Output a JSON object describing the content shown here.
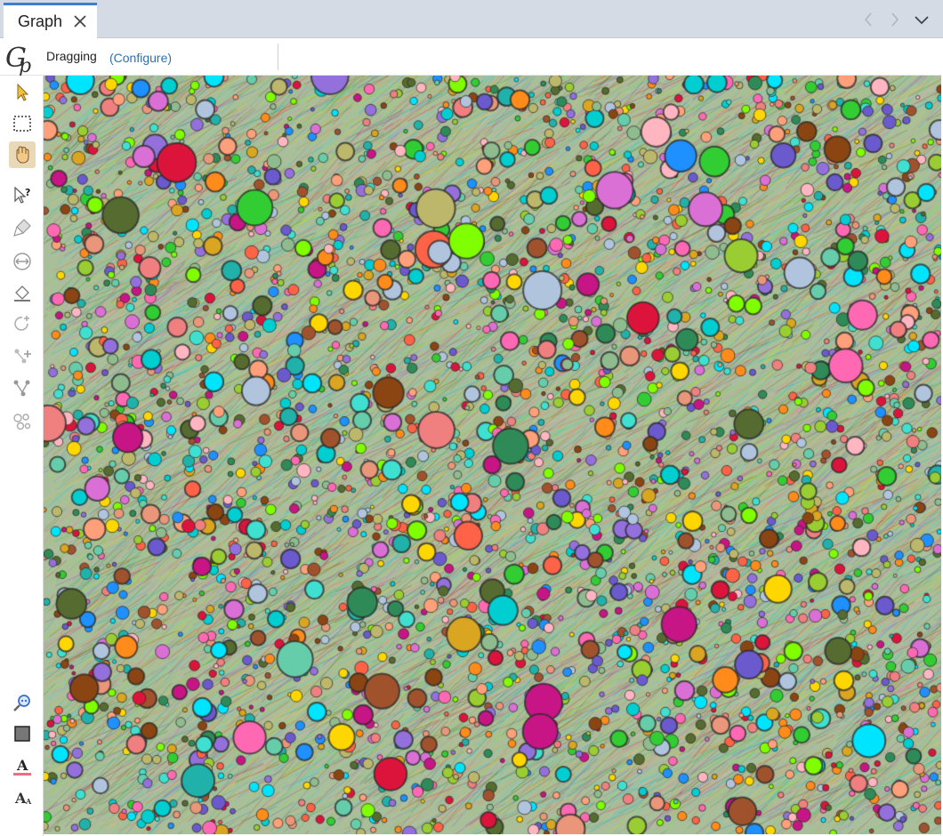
{
  "tab": {
    "title": "Graph"
  },
  "toolbar": {
    "mode_label": "Dragging",
    "configure_link": "(Configure)"
  },
  "tools": [
    {
      "name": "select-pointer-tool",
      "icon": "pointer-icon",
      "active": false
    },
    {
      "name": "rectangle-select-tool",
      "icon": "marquee-icon",
      "active": false
    },
    {
      "name": "drag-hand-tool",
      "icon": "hand-icon",
      "active": true
    },
    {
      "name": "edit-info-tool",
      "icon": "pointer-question-icon",
      "active": false
    },
    {
      "name": "painter-tool",
      "icon": "brush-icon",
      "active": false
    },
    {
      "name": "size-tool",
      "icon": "resize-icon",
      "active": false
    },
    {
      "name": "color-fill-tool",
      "icon": "bucket-icon",
      "active": false
    },
    {
      "name": "rotate-tool",
      "icon": "rotate-icon",
      "active": false
    },
    {
      "name": "add-node-tool",
      "icon": "add-node-icon",
      "active": false
    },
    {
      "name": "add-edge-tool",
      "icon": "add-edge-icon",
      "active": false
    },
    {
      "name": "shortest-path-tool",
      "icon": "path-icon",
      "active": false
    }
  ],
  "bottom_tools": [
    {
      "name": "zoom-tool",
      "icon": "magnifier-icon"
    },
    {
      "name": "background-color-tool",
      "icon": "square-icon"
    },
    {
      "name": "label-color-tool",
      "icon": "text-color-icon"
    },
    {
      "name": "label-size-tool",
      "icon": "text-size-icon"
    }
  ],
  "colors": {
    "tab_accent": "#3a7fd0",
    "link": "#2d6fb5",
    "active_tool": "#e9d9b8",
    "node_palette": [
      "#ff8c1a",
      "#00e5ff",
      "#9acd32",
      "#f08080",
      "#da70d6",
      "#66cdaa",
      "#ffd700",
      "#ff69b4",
      "#32cd32",
      "#8b4513",
      "#556b2f",
      "#9370db",
      "#40e0d0",
      "#dc143c",
      "#1e90ff",
      "#ffa07a",
      "#b0c4de",
      "#8fbc8f",
      "#c71585",
      "#2e8b57",
      "#ffb6c1",
      "#daa520",
      "#00ced1",
      "#7fff00",
      "#a0522d",
      "#ff6347",
      "#6a5acd",
      "#20b2aa",
      "#e9967a",
      "#bdb76b"
    ]
  }
}
